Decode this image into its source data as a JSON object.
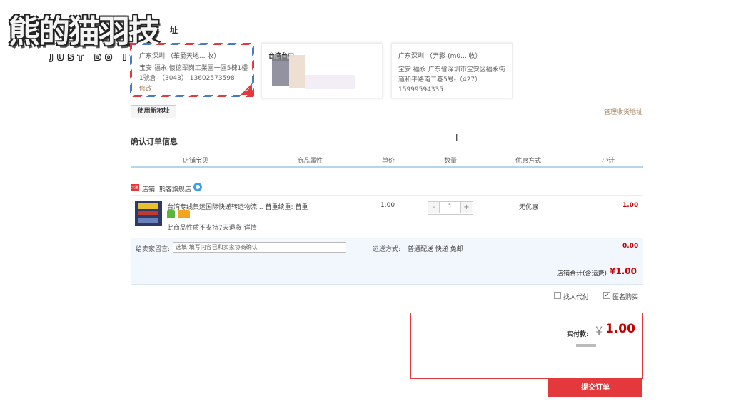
{
  "logo": {
    "main": "熊的猫羽技",
    "sub": "JUST DO IT"
  },
  "address_section": {
    "title_tail": "址"
  },
  "addresses": [
    {
      "name": "广东深圳 （華爵天地... 收）",
      "address": "宝安 福永 懷德翠岗工業園一區5棟1樓1號倉-（3043） 13602573598",
      "action": "修改"
    },
    {
      "name": "台湾台中"
    },
    {
      "name": "广东深圳 （尹影-(m0... 收）",
      "address": "宝安 福永 广东省深圳市宝安区福永街道和平路南二巷5号-（427） 15999594335"
    }
  ],
  "use_new_address": "使用新地址",
  "manage_addresses": "管理收货地址",
  "confirm_title": "确认订单信息",
  "columns": [
    "店铺宝贝",
    "商品属性",
    "单价",
    "数量",
    "优惠方式",
    "小计"
  ],
  "shop": {
    "badge": "天猫",
    "label": "店铺: 熊客旗舰店"
  },
  "product": {
    "title": "台湾专线集运国际快递转运物流... 首重续重: 首重",
    "note": "此商品性质不支持7天退货 详情",
    "price": "1.00",
    "quantity": "1",
    "discount": "无优惠",
    "subtotal": "1.00"
  },
  "message": {
    "label": "给卖家留言:",
    "placeholder": "选填:填写内容已和卖家协商确认"
  },
  "shipping": {
    "label": "运送方式:",
    "value": "普通配送 快递 免邮",
    "fee": "0.00"
  },
  "shop_total": {
    "label": "店铺合计(含运费)",
    "value": "¥1.00"
  },
  "options": [
    {
      "label": "找人代付",
      "checked": false
    },
    {
      "label": "匿名购买",
      "checked": true
    }
  ],
  "payment": {
    "label": "实付款:",
    "currency": "¥",
    "amount": "1.00"
  },
  "submit": "提交订单",
  "colors": {
    "accent": "#e4393c",
    "price": "#c40000",
    "header_line": "#b6d4ec",
    "panel": "#f2f7fd"
  }
}
